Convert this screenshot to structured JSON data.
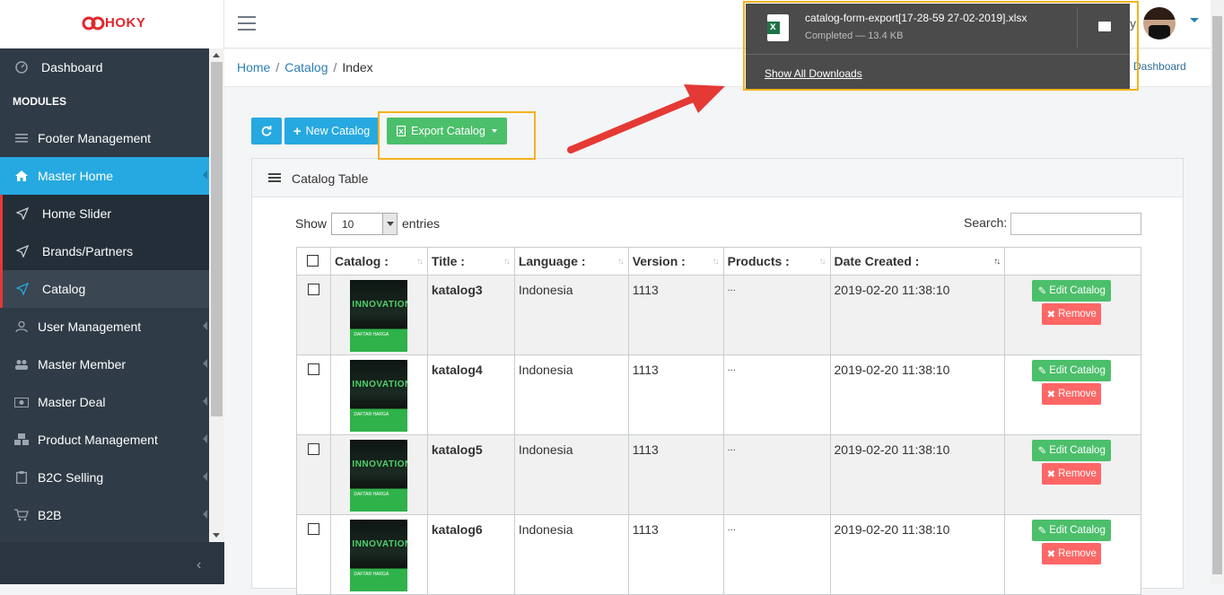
{
  "brand": {
    "logo_text": "HOKY",
    "logo_color": "#e3262c"
  },
  "sidebar": {
    "dashboard": "Dashboard",
    "modules_heading": "MODULES",
    "items": [
      {
        "label": "Footer Management",
        "icon": "bars-icon"
      },
      {
        "label": "Master Home",
        "icon": "home-icon"
      },
      {
        "label": "Home Slider",
        "icon": "send-icon"
      },
      {
        "label": "Brands/Partners",
        "icon": "send-icon"
      },
      {
        "label": "Catalog",
        "icon": "send-icon"
      },
      {
        "label": "User Management",
        "icon": "user-icon"
      },
      {
        "label": "Master Member",
        "icon": "users-icon"
      },
      {
        "label": "Master Deal",
        "icon": "money-icon"
      },
      {
        "label": "Product Management",
        "icon": "cubes-icon"
      },
      {
        "label": "B2C Selling",
        "icon": "clipboard-icon"
      },
      {
        "label": "B2B",
        "icon": "cart-icon"
      }
    ],
    "accent": "#26a9e0"
  },
  "topbar": {
    "user_initial": "y"
  },
  "breadcrumb": {
    "home": "Home",
    "catalog": "Catalog",
    "current": "Index",
    "right_link": "Dashboard"
  },
  "toolbar": {
    "new_catalog": "New Catalog",
    "export_catalog": "Export Catalog"
  },
  "panel": {
    "title": "Catalog Table",
    "show_label": "Show",
    "page_length": "10",
    "entries_label": "entries",
    "search_label": "Search:",
    "columns": [
      "Catalog :",
      "Title :",
      "Language :",
      "Version :",
      "Products :",
      "Date Created :"
    ],
    "rows": [
      {
        "title": "katalog3",
        "language": "Indonesia",
        "version": "1113",
        "products": "...",
        "date": "2019-02-20 11:38:10"
      },
      {
        "title": "katalog4",
        "language": "Indonesia",
        "version": "1113",
        "products": "...",
        "date": "2019-02-20 11:38:10"
      },
      {
        "title": "katalog5",
        "language": "Indonesia",
        "version": "1113",
        "products": "...",
        "date": "2019-02-20 11:38:10"
      },
      {
        "title": "katalog6",
        "language": "Indonesia",
        "version": "1113",
        "products": "...",
        "date": "2019-02-20 11:38:10"
      }
    ],
    "edit_label": "Edit Catalog",
    "remove_label": "Remove",
    "thumb_text": "INNOVATION",
    "thumb_sub": "DAFTAR HARGA"
  },
  "download": {
    "filename": "catalog-form-export[17-28-59 27-02-2019].xlsx",
    "status": "Completed — 13.4 KB",
    "show_all": "Show All Downloads"
  },
  "colors": {
    "highlight": "#f5b21d",
    "arrow": "#e53935",
    "green": "#4cbf6b",
    "red": "#ff6666"
  }
}
